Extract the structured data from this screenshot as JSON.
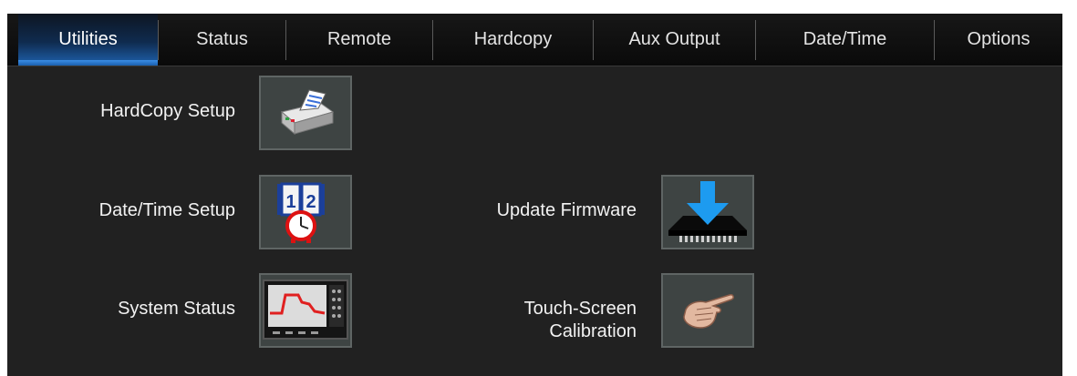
{
  "tabs": [
    {
      "label": "Utilities",
      "active": true
    },
    {
      "label": "Status",
      "active": false
    },
    {
      "label": "Remote",
      "active": false
    },
    {
      "label": "Hardcopy",
      "active": false
    },
    {
      "label": "Aux Output",
      "active": false
    },
    {
      "label": "Date/Time",
      "active": false
    },
    {
      "label": "Options",
      "active": false
    }
  ],
  "utilities": {
    "hardcopy_setup": {
      "label": "HardCopy Setup",
      "icon": "printer-icon"
    },
    "datetime_setup": {
      "label": "Date/Time Setup",
      "icon": "calendar-clock-icon"
    },
    "system_status": {
      "label": "System Status",
      "icon": "oscilloscope-icon"
    },
    "update_firmware": {
      "label": "Update Firmware",
      "icon": "firmware-download-icon"
    },
    "touch_calibration": {
      "line1": "Touch-Screen",
      "line2": "Calibration",
      "icon": "pointing-hand-icon"
    }
  },
  "colors": {
    "panel_bg": "#212121",
    "tab_active": "#1f63b0",
    "button_bg": "#3e4443",
    "text": "#f2f2f2"
  }
}
